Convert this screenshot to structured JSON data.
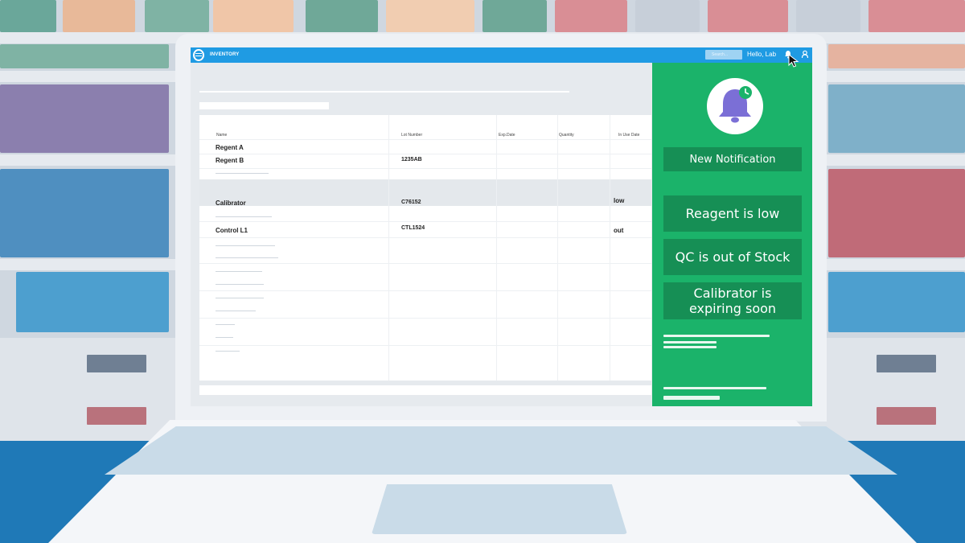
{
  "app": {
    "title": "INVENTORY",
    "search_placeholder": "Search...",
    "greeting": "Hello, Lab"
  },
  "icons": {
    "logo": "app-logo-icon",
    "bell": "bell-icon",
    "user": "user-icon",
    "cursor": "mouse-pointer-icon"
  },
  "table": {
    "columns": [
      "Name",
      "Lot Number",
      "Exp.Date",
      "Quantity",
      "In Use Date"
    ],
    "rows": [
      {
        "name": "Regent A",
        "lot": "",
        "status": ""
      },
      {
        "name": "Regent B",
        "lot": "1235AB",
        "status": ""
      },
      {
        "name": "Calibrator",
        "lot": "C76152",
        "status": "low"
      },
      {
        "name": "Control L1",
        "lot": "CTL1524",
        "status": "out"
      }
    ]
  },
  "notifications": {
    "header": "New Notification",
    "items": [
      "Reagent is low",
      "QC is out of Stock",
      "Calibrator is expiring soon"
    ]
  },
  "colors": {
    "topbar": "#1f9be3",
    "panel": "#1bb36a",
    "card": "#168f55",
    "bell": "#7b6fd6",
    "bell_badge": "#1bb36a"
  }
}
